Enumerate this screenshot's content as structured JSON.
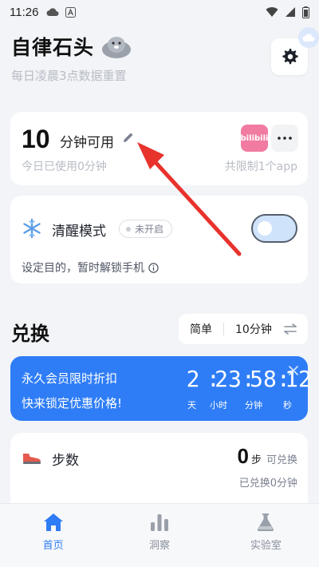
{
  "status_bar": {
    "time": "11:26"
  },
  "header": {
    "title": "自律石头",
    "subtitle": "每日凌晨3点数据重置"
  },
  "time_card": {
    "available_number": "10",
    "available_unit": "分钟可用",
    "used_today": "今日已使用0分钟",
    "limit_text": "共限制1个app",
    "app_icon_label": "bilibili"
  },
  "focus_mode": {
    "title": "清醒模式",
    "status": "未开启",
    "description": "设定目的，暂时解锁手机",
    "toggle_on": false
  },
  "exchange": {
    "title": "兑换",
    "mode_simple": "简单",
    "mode_duration": "10分钟"
  },
  "promo": {
    "title": "永久会员限时折扣",
    "subtitle": "快来锁定优惠价格!",
    "days": "2",
    "hours": "23",
    "minutes": "58",
    "seconds": "12",
    "label_days": "天",
    "label_hours": "小时",
    "label_minutes": "分钟",
    "label_seconds": "秒"
  },
  "steps_card": {
    "title": "步数",
    "count": "0",
    "unit": "步",
    "exchangeable": "可兑换",
    "exchanged": "已兑换0分钟"
  },
  "bottom_nav": [
    {
      "label": "首页",
      "icon": "home-icon",
      "active": true
    },
    {
      "label": "洞察",
      "icon": "bar-chart-icon",
      "active": false
    },
    {
      "label": "实验室",
      "icon": "flask-icon",
      "active": false
    }
  ],
  "colors": {
    "accent": "#2f7df6",
    "annotation": "#e8322c"
  }
}
